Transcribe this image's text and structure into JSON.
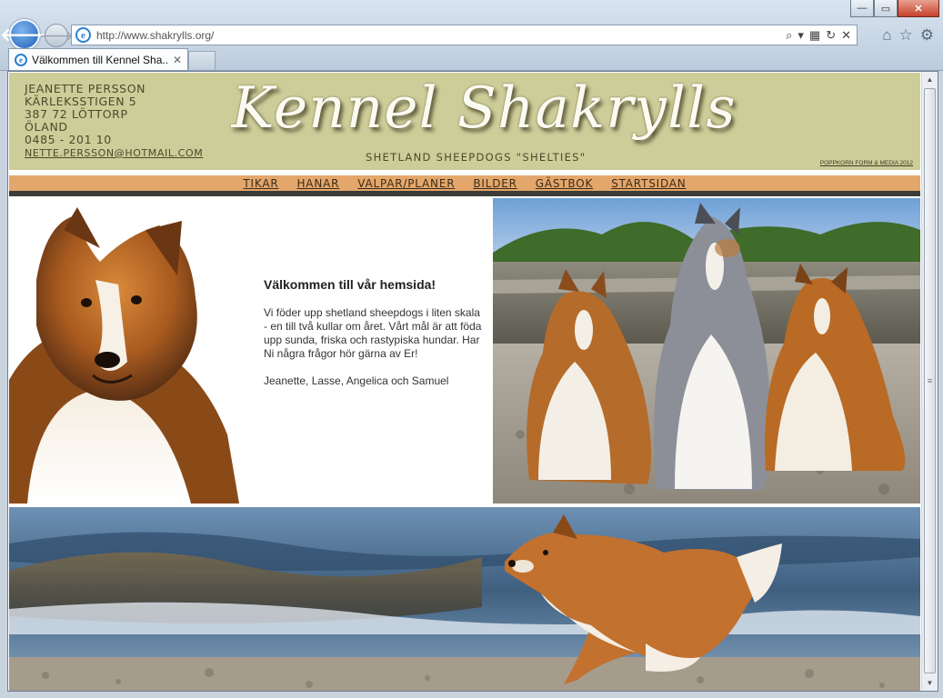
{
  "browser": {
    "url": "http://www.shakrylls.org/",
    "tab_title": "Välkommen till Kennel Sha...",
    "win_min": "—",
    "win_max": "▭",
    "win_close": "✕",
    "back_icon": "🡐",
    "forward_icon": "🡒"
  },
  "header": {
    "contact_lines": [
      "JEANETTE PERSSON",
      "KÄRLEKSSTIGEN 5",
      "387 72 LÖTTORP",
      "ÖLAND",
      "0485 - 201 10"
    ],
    "email": "NETTE.PERSSON@HOTMAIL.COM",
    "logo": "Kennel Shakrylls",
    "subtitle": "SHETLAND SHEEPDOGS \"SHELTIES\"",
    "credit": "POPPKORN FORM & MEDIA 2012"
  },
  "nav": {
    "items": [
      "TIKAR",
      "HANAR",
      "VALPAR/PLANER",
      "BILDER",
      "GÄSTBOK",
      "STARTSIDAN"
    ]
  },
  "intro": {
    "heading": "Välkommen till vår hemsida!",
    "paragraph1": "Vi föder upp shetland sheepdogs i liten skala - en till två kullar om året. Vårt mål är att föda upp sunda, friska och rastypiska hundar. Har Ni några frågor hör gärna av Er!",
    "signature": "Jeanette, Lasse, Angelica och Samuel"
  },
  "colors": {
    "header_bg": "#cdcd99",
    "nav_bg": "#e3a76b",
    "nav_bottom": "#3c3c38"
  }
}
